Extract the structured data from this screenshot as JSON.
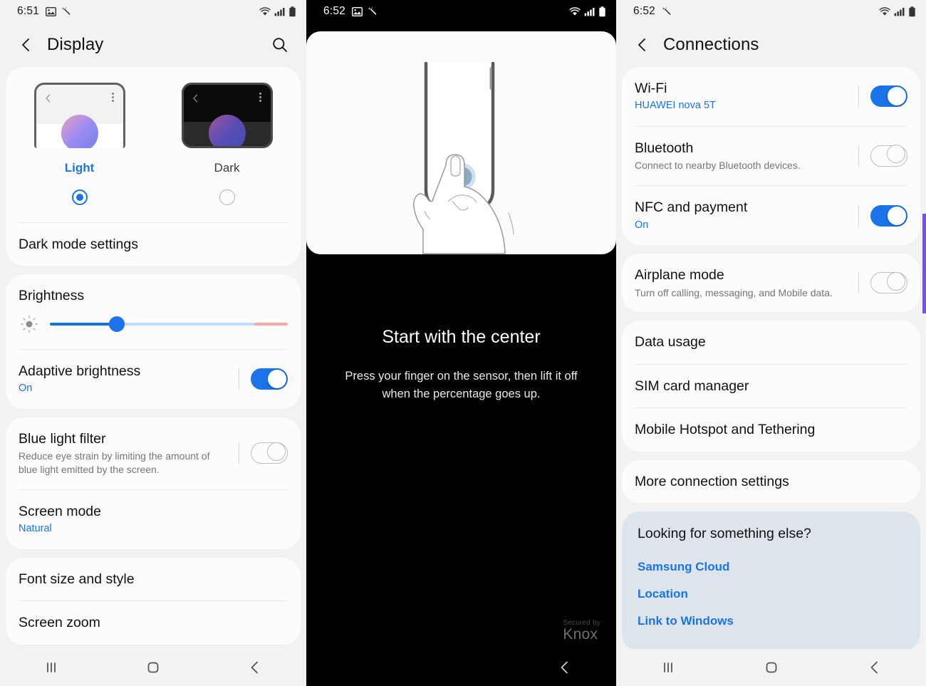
{
  "screens": [
    {
      "id": "display-settings",
      "statusbar": {
        "time": "6:51",
        "left_icons": [
          "image-icon",
          "magic-wand-icon"
        ],
        "right_icons": [
          "wifi-icon",
          "signal-icon",
          "battery-icon"
        ]
      },
      "appbar": {
        "title": "Display",
        "back_icon": "back-chevron-icon",
        "search_icon": "search-icon"
      },
      "theme": {
        "options": [
          {
            "name": "Light",
            "selected": true
          },
          {
            "name": "Dark",
            "selected": false
          }
        ],
        "dark_mode_settings": "Dark mode settings"
      },
      "brightness": {
        "title": "Brightness",
        "value_percent": 28,
        "warm_start_percent": 86,
        "adaptive": {
          "label": "Adaptive brightness",
          "value": "On",
          "toggle": "on"
        }
      },
      "blue_light": {
        "label": "Blue light filter",
        "desc": "Reduce eye strain by limiting the amount of blue light emitted by the screen.",
        "toggle": "off"
      },
      "screen_mode": {
        "label": "Screen mode",
        "value": "Natural"
      },
      "font_size": {
        "label": "Font size and style"
      },
      "screen_zoom": {
        "label": "Screen zoom"
      },
      "navbar": [
        "recents-icon",
        "home-icon",
        "back-icon"
      ]
    },
    {
      "id": "fingerprint-enroll",
      "statusbar": {
        "time": "6:52",
        "left_icons": [
          "image-icon",
          "magic-wand-icon"
        ],
        "right_icons": [
          "wifi-icon",
          "signal-icon",
          "battery-icon"
        ]
      },
      "illustration": "finger-on-sensor-illustration",
      "heading": "Start with the center",
      "description": "Press your finger on the sensor, then lift it off when the percentage goes up.",
      "knox": {
        "line1": "Secured by",
        "line2": "Knox"
      },
      "navbar": [
        "back-icon"
      ]
    },
    {
      "id": "connections-settings",
      "statusbar": {
        "time": "6:52",
        "left_icons": [
          "magic-wand-icon"
        ],
        "right_icons": [
          "wifi-icon",
          "signal-icon",
          "battery-icon"
        ]
      },
      "appbar": {
        "title": "Connections",
        "back_icon": "back-chevron-icon"
      },
      "group1": [
        {
          "label": "Wi-Fi",
          "sub": "HUAWEI nova 5T",
          "sub_style": "blue",
          "toggle": "on"
        },
        {
          "label": "Bluetooth",
          "sub": "Connect to nearby Bluetooth devices.",
          "sub_style": "gray",
          "toggle": "off"
        },
        {
          "label": "NFC and payment",
          "sub": "On",
          "sub_style": "blue",
          "toggle": "on"
        }
      ],
      "group2": [
        {
          "label": "Airplane mode",
          "sub": "Turn off calling, messaging, and Mobile data.",
          "sub_style": "gray",
          "toggle": "off"
        }
      ],
      "group3": [
        {
          "label": "Data usage"
        },
        {
          "label": "SIM card manager"
        },
        {
          "label": "Mobile Hotspot and Tethering"
        }
      ],
      "group4": [
        {
          "label": "More connection settings"
        }
      ],
      "help": {
        "title": "Looking for something else?",
        "links": [
          "Samsung Cloud",
          "Location",
          "Link to Windows"
        ]
      },
      "navbar": [
        "recents-icon",
        "home-icon",
        "back-icon"
      ]
    }
  ],
  "colors": {
    "accent_blue": "#1a73e8",
    "card_bg": "#fcfcfc",
    "page_bg": "#f2f2f2",
    "help_card_bg": "#dde5ec",
    "warm_slider": "#f5a8a4",
    "edge_purple": "#7a4cf5"
  }
}
